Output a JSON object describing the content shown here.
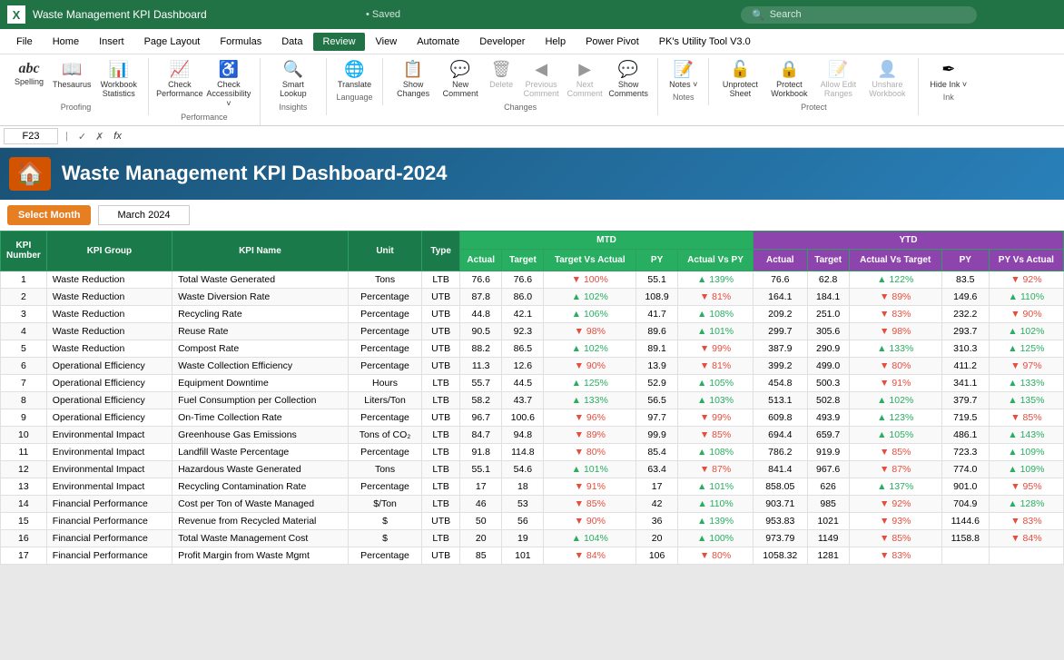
{
  "titleBar": {
    "appIcon": "X",
    "fileTitle": "Waste Management KPI Dashboard",
    "saved": "• Saved",
    "searchPlaceholder": "Search"
  },
  "menuBar": {
    "items": [
      "File",
      "Home",
      "Insert",
      "Page Layout",
      "Formulas",
      "Data",
      "Review",
      "View",
      "Automate",
      "Developer",
      "Help",
      "Power Pivot",
      "PK's Utility Tool V3.0"
    ]
  },
  "ribbon": {
    "groups": [
      {
        "label": "Proofing",
        "items": [
          {
            "id": "spelling",
            "icon": "abc",
            "label": "Spelling",
            "disabled": false
          },
          {
            "id": "thesaurus",
            "icon": "📖",
            "label": "Thesaurus",
            "disabled": false
          },
          {
            "id": "workbook-stats",
            "icon": "123",
            "label": "Workbook Statistics",
            "disabled": false
          }
        ]
      },
      {
        "label": "Performance",
        "items": [
          {
            "id": "check-performance",
            "icon": "📊",
            "label": "Check Performance",
            "disabled": false
          },
          {
            "id": "check-accessibility",
            "icon": "✓",
            "label": "Check Accessibility ˅",
            "disabled": false
          }
        ]
      },
      {
        "label": "Insights",
        "items": [
          {
            "id": "smart-lookup",
            "icon": "🔍",
            "label": "Smart Lookup",
            "disabled": false
          }
        ]
      },
      {
        "label": "Language",
        "items": [
          {
            "id": "translate",
            "icon": "🌐",
            "label": "Translate",
            "disabled": false
          }
        ]
      },
      {
        "label": "Changes",
        "items": [
          {
            "id": "show-changes",
            "icon": "📋",
            "label": "Show Changes",
            "disabled": false
          },
          {
            "id": "new-comment",
            "icon": "💬",
            "label": "New Comment",
            "disabled": false
          },
          {
            "id": "delete-comment",
            "icon": "🗑",
            "label": "Delete",
            "disabled": true
          },
          {
            "id": "prev-comment",
            "icon": "◀",
            "label": "Previous Comment",
            "disabled": true
          },
          {
            "id": "next-comment",
            "icon": "▶",
            "label": "Next Comment",
            "disabled": true
          },
          {
            "id": "show-comments",
            "icon": "💬",
            "label": "Show Comments",
            "disabled": false
          }
        ]
      },
      {
        "label": "Notes",
        "items": [
          {
            "id": "notes",
            "icon": "📝",
            "label": "Notes ˅",
            "disabled": false
          }
        ]
      },
      {
        "label": "Protect",
        "items": [
          {
            "id": "unprotect-sheet",
            "icon": "🔓",
            "label": "Unprotect Sheet",
            "disabled": false
          },
          {
            "id": "protect-workbook",
            "icon": "🔒",
            "label": "Protect Workbook",
            "disabled": false
          },
          {
            "id": "allow-edit-ranges",
            "icon": "📝",
            "label": "Allow Edit Ranges",
            "disabled": true
          },
          {
            "id": "unshare-workbook",
            "icon": "👤",
            "label": "Unshare Workbook",
            "disabled": true
          }
        ]
      },
      {
        "label": "Ink",
        "items": [
          {
            "id": "hide-ink",
            "icon": "✒",
            "label": "Hide Ink ˅",
            "disabled": false
          }
        ]
      }
    ]
  },
  "formulaBar": {
    "cellRef": "F23",
    "formula": ""
  },
  "dashboard": {
    "title": "Waste Management KPI Dashboard-2024",
    "selectMonthLabel": "Select Month",
    "selectedMonth": "March 2024",
    "sections": {
      "mtd": "MTD",
      "ytd": "YTD"
    },
    "headers": {
      "kpiNumber": "KPI Number",
      "kpiGroup": "KPI Group",
      "kpiName": "KPI Name",
      "unit": "Unit",
      "type": "Type",
      "actual": "Actual",
      "target": "Target",
      "targetVsActual": "Target Vs Actual",
      "py": "PY",
      "actualVsPY": "Actual Vs PY",
      "ytdActual": "Actual",
      "ytdTarget": "Target",
      "ytdActualVsTarget": "Actual Vs Target",
      "ytdPY": "PY",
      "ytdPYVsActual": "PY Vs Actual"
    },
    "rows": [
      {
        "num": 1,
        "group": "Waste Reduction",
        "name": "Total Waste Generated",
        "unit": "Tons",
        "type": "LTB",
        "actual": "76.6",
        "target": "76.6",
        "tvA": "▼ 100%",
        "py": "55.1",
        "avPY": "▲ 139%",
        "ytdActual": "76.6",
        "ytdTarget": "62.8",
        "ytdAvT": "▲ 122%",
        "ytdPY": "83.5",
        "ytdPYvA": "▼ 92%"
      },
      {
        "num": 2,
        "group": "Waste Reduction",
        "name": "Waste Diversion Rate",
        "unit": "Percentage",
        "type": "UTB",
        "actual": "87.8",
        "target": "86.0",
        "tvA": "▲ 102%",
        "py": "108.9",
        "avPY": "▼ 81%",
        "ytdActual": "164.1",
        "ytdTarget": "184.1",
        "ytdAvT": "▼ 89%",
        "ytdPY": "149.6",
        "ytdPYvA": "▲ 110%"
      },
      {
        "num": 3,
        "group": "Waste Reduction",
        "name": "Recycling Rate",
        "unit": "Percentage",
        "type": "UTB",
        "actual": "44.8",
        "target": "42.1",
        "tvA": "▲ 106%",
        "py": "41.7",
        "avPY": "▲ 108%",
        "ytdActual": "209.2",
        "ytdTarget": "251.0",
        "ytdAvT": "▼ 83%",
        "ytdPY": "232.2",
        "ytdPYvA": "▼ 90%"
      },
      {
        "num": 4,
        "group": "Waste Reduction",
        "name": "Reuse Rate",
        "unit": "Percentage",
        "type": "UTB",
        "actual": "90.5",
        "target": "92.3",
        "tvA": "▼ 98%",
        "py": "89.6",
        "avPY": "▲ 101%",
        "ytdActual": "299.7",
        "ytdTarget": "305.6",
        "ytdAvT": "▼ 98%",
        "ytdPY": "293.7",
        "ytdPYvA": "▲ 102%"
      },
      {
        "num": 5,
        "group": "Waste Reduction",
        "name": "Compost Rate",
        "unit": "Percentage",
        "type": "UTB",
        "actual": "88.2",
        "target": "86.5",
        "tvA": "▲ 102%",
        "py": "89.1",
        "avPY": "▼ 99%",
        "ytdActual": "387.9",
        "ytdTarget": "290.9",
        "ytdAvT": "▲ 133%",
        "ytdPY": "310.3",
        "ytdPYvA": "▲ 125%"
      },
      {
        "num": 6,
        "group": "Operational Efficiency",
        "name": "Waste Collection Efficiency",
        "unit": "Percentage",
        "type": "UTB",
        "actual": "11.3",
        "target": "12.6",
        "tvA": "▼ 90%",
        "py": "13.9",
        "avPY": "▼ 81%",
        "ytdActual": "399.2",
        "ytdTarget": "499.0",
        "ytdAvT": "▼ 80%",
        "ytdPY": "411.2",
        "ytdPYvA": "▼ 97%"
      },
      {
        "num": 7,
        "group": "Operational Efficiency",
        "name": "Equipment Downtime",
        "unit": "Hours",
        "type": "LTB",
        "actual": "55.7",
        "target": "44.5",
        "tvA": "▲ 125%",
        "py": "52.9",
        "avPY": "▲ 105%",
        "ytdActual": "454.8",
        "ytdTarget": "500.3",
        "ytdAvT": "▼ 91%",
        "ytdPY": "341.1",
        "ytdPYvA": "▲ 133%"
      },
      {
        "num": 8,
        "group": "Operational Efficiency",
        "name": "Fuel Consumption per Collection",
        "unit": "Liters/Ton",
        "type": "LTB",
        "actual": "58.2",
        "target": "43.7",
        "tvA": "▲ 133%",
        "py": "56.5",
        "avPY": "▲ 103%",
        "ytdActual": "513.1",
        "ytdTarget": "502.8",
        "ytdAvT": "▲ 102%",
        "ytdPY": "379.7",
        "ytdPYvA": "▲ 135%"
      },
      {
        "num": 9,
        "group": "Operational Efficiency",
        "name": "On-Time Collection Rate",
        "unit": "Percentage",
        "type": "UTB",
        "actual": "96.7",
        "target": "100.6",
        "tvA": "▼ 96%",
        "py": "97.7",
        "avPY": "▼ 99%",
        "ytdActual": "609.8",
        "ytdTarget": "493.9",
        "ytdAvT": "▲ 123%",
        "ytdPY": "719.5",
        "ytdPYvA": "▼ 85%"
      },
      {
        "num": 10,
        "group": "Environmental Impact",
        "name": "Greenhouse Gas Emissions",
        "unit": "Tons of CO₂",
        "type": "LTB",
        "actual": "84.7",
        "target": "94.8",
        "tvA": "▼ 89%",
        "py": "99.9",
        "avPY": "▼ 85%",
        "ytdActual": "694.4",
        "ytdTarget": "659.7",
        "ytdAvT": "▲ 105%",
        "ytdPY": "486.1",
        "ytdPYvA": "▲ 143%"
      },
      {
        "num": 11,
        "group": "Environmental Impact",
        "name": "Landfill Waste Percentage",
        "unit": "Percentage",
        "type": "LTB",
        "actual": "91.8",
        "target": "114.8",
        "tvA": "▼ 80%",
        "py": "85.4",
        "avPY": "▲ 108%",
        "ytdActual": "786.2",
        "ytdTarget": "919.9",
        "ytdAvT": "▼ 85%",
        "ytdPY": "723.3",
        "ytdPYvA": "▲ 109%"
      },
      {
        "num": 12,
        "group": "Environmental Impact",
        "name": "Hazardous Waste Generated",
        "unit": "Tons",
        "type": "LTB",
        "actual": "55.1",
        "target": "54.6",
        "tvA": "▲ 101%",
        "py": "63.4",
        "avPY": "▼ 87%",
        "ytdActual": "841.4",
        "ytdTarget": "967.6",
        "ytdAvT": "▼ 87%",
        "ytdPY": "774.0",
        "ytdPYvA": "▲ 109%"
      },
      {
        "num": 13,
        "group": "Environmental Impact",
        "name": "Recycling Contamination Rate",
        "unit": "Percentage",
        "type": "LTB",
        "actual": "17",
        "target": "18",
        "tvA": "▼ 91%",
        "py": "17",
        "avPY": "▲ 101%",
        "ytdActual": "858.05",
        "ytdTarget": "626",
        "ytdAvT": "▲ 137%",
        "ytdPY": "901.0",
        "ytdPYvA": "▼ 95%"
      },
      {
        "num": 14,
        "group": "Financial Performance",
        "name": "Cost per Ton of Waste Managed",
        "unit": "$/Ton",
        "type": "LTB",
        "actual": "46",
        "target": "53",
        "tvA": "▼ 85%",
        "py": "42",
        "avPY": "▲ 110%",
        "ytdActual": "903.71",
        "ytdTarget": "985",
        "ytdAvT": "▼ 92%",
        "ytdPY": "704.9",
        "ytdPYvA": "▲ 128%"
      },
      {
        "num": 15,
        "group": "Financial Performance",
        "name": "Revenue from Recycled Material",
        "unit": "$",
        "type": "UTB",
        "actual": "50",
        "target": "56",
        "tvA": "▼ 90%",
        "py": "36",
        "avPY": "▲ 139%",
        "ytdActual": "953.83",
        "ytdTarget": "1021",
        "ytdAvT": "▼ 93%",
        "ytdPY": "1144.6",
        "ytdPYvA": "▼ 83%"
      },
      {
        "num": 16,
        "group": "Financial Performance",
        "name": "Total Waste Management Cost",
        "unit": "$",
        "type": "LTB",
        "actual": "20",
        "target": "19",
        "tvA": "▲ 104%",
        "py": "20",
        "avPY": "▲ 100%",
        "ytdActual": "973.79",
        "ytdTarget": "1149",
        "ytdAvT": "▼ 85%",
        "ytdPY": "1158.8",
        "ytdPYvA": "▼ 84%"
      },
      {
        "num": 17,
        "group": "Financial Performance",
        "name": "Profit Margin from Waste Mgmt",
        "unit": "Percentage",
        "type": "UTB",
        "actual": "85",
        "target": "101",
        "tvA": "▼ 84%",
        "py": "106",
        "avPY": "▼ 80%",
        "ytdActual": "1058.32",
        "ytdTarget": "1281",
        "ytdAvT": "▼ 83%",
        "ytdPY": "",
        "ytdPYvA": ""
      }
    ]
  }
}
